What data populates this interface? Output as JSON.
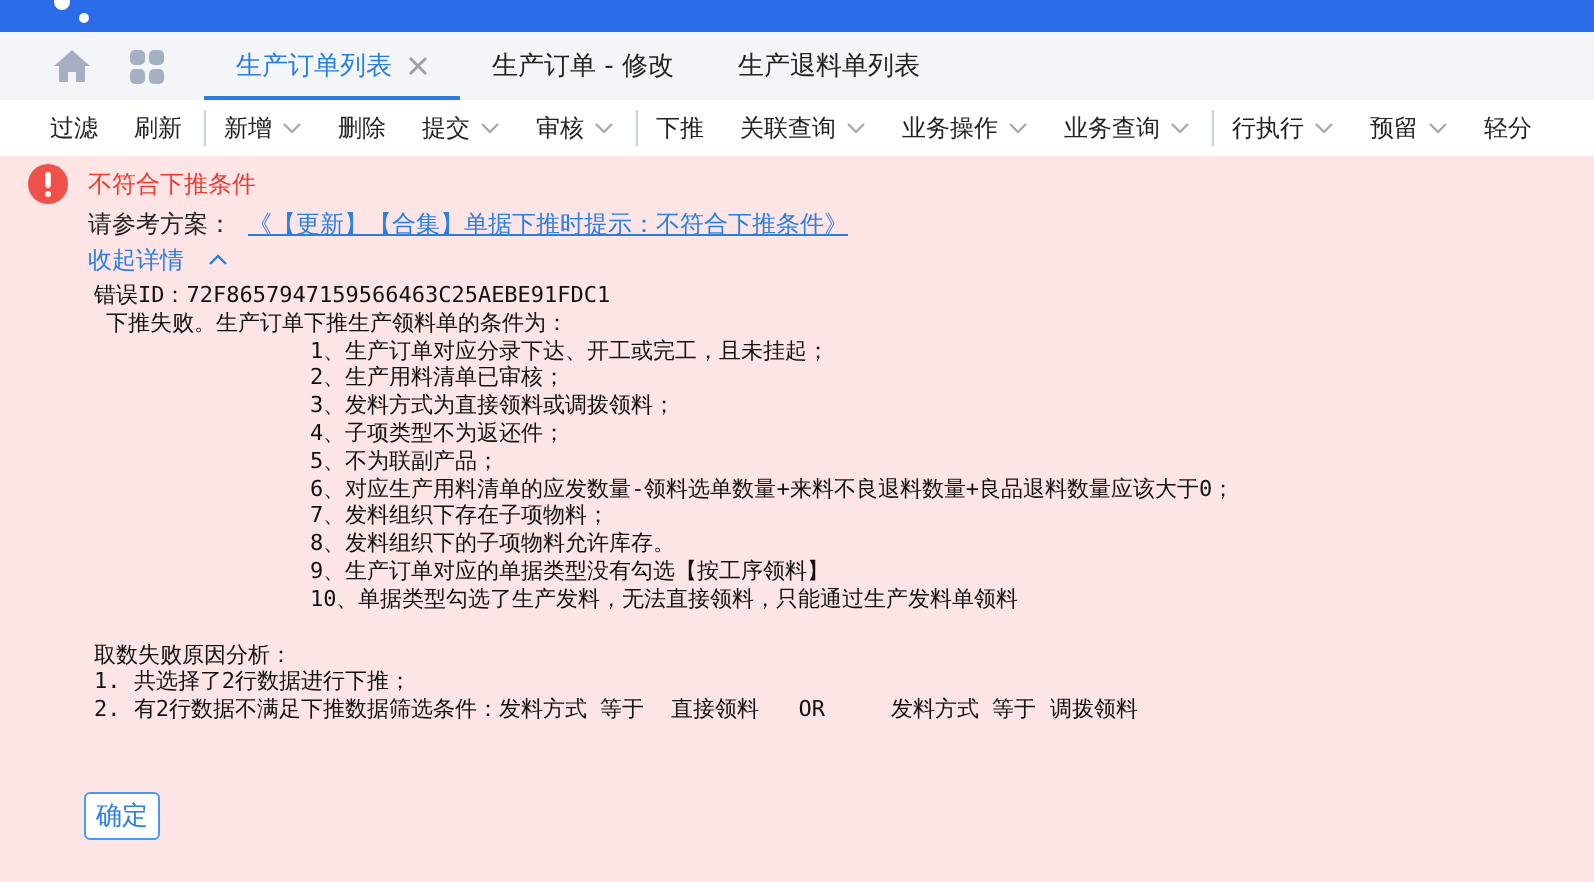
{
  "tabs": [
    {
      "label": "生产订单列表",
      "selected": true,
      "closable": true
    },
    {
      "label": "生产订单 - 修改",
      "selected": false,
      "closable": false
    },
    {
      "label": "生产退料单列表",
      "selected": false,
      "closable": false
    }
  ],
  "toolbar": [
    {
      "label": "过滤",
      "dropdown": false,
      "separator_before": false
    },
    {
      "label": "刷新",
      "dropdown": false,
      "separator_before": false
    },
    {
      "label": "新增",
      "dropdown": true,
      "separator_before": true
    },
    {
      "label": "删除",
      "dropdown": false,
      "separator_before": false
    },
    {
      "label": "提交",
      "dropdown": true,
      "separator_before": false
    },
    {
      "label": "审核",
      "dropdown": true,
      "separator_before": false
    },
    {
      "label": "下推",
      "dropdown": false,
      "separator_before": true
    },
    {
      "label": "关联查询",
      "dropdown": true,
      "separator_before": false
    },
    {
      "label": "业务操作",
      "dropdown": true,
      "separator_before": false
    },
    {
      "label": "业务查询",
      "dropdown": true,
      "separator_before": false
    },
    {
      "label": "行执行",
      "dropdown": true,
      "separator_before": true
    },
    {
      "label": "预留",
      "dropdown": true,
      "separator_before": false
    },
    {
      "label": "轻分",
      "dropdown": false,
      "separator_before": false
    }
  ],
  "error": {
    "title": "不符合下推条件",
    "reference_label": "请参考方案：",
    "reference_link": "《【更新】【合集】单据下推时提示：不符合下推条件》",
    "collapse_label": "收起详情",
    "expanded": true,
    "error_id": "错误ID：72F8657947159566463C25AEBE91FDC1",
    "summary": "下推失败。生产订单下推生产领料单的条件为：",
    "conditions": [
      "1、生产订单对应分录下达、开工或完工，且未挂起；",
      "2、生产用料清单已审核；",
      "3、发料方式为直接领料或调拨领料；",
      "4、子项类型不为返还件；",
      "5、不为联副产品；",
      "6、对应生产用料清单的应发数量-领料选单数量+来料不良退料数量+良品退料数量应该大于0；",
      "7、发料组织下存在子项物料；",
      "8、发料组织下的子项物料允许库存。",
      "9、生产订单对应的单据类型没有勾选【按工序领料】",
      "10、单据类型勾选了生产发料，无法直接领料，只能通过生产发料单领料"
    ],
    "analysis_title": "取数失败原因分析：",
    "analysis": [
      "1. 共选择了2行数据进行下推；",
      "2. 有2行数据不满足下推数据筛选条件：发料方式 等于  直接领料   OR     发料方式 等于 调拨领料"
    ]
  },
  "buttons": [
    "确定"
  ]
}
